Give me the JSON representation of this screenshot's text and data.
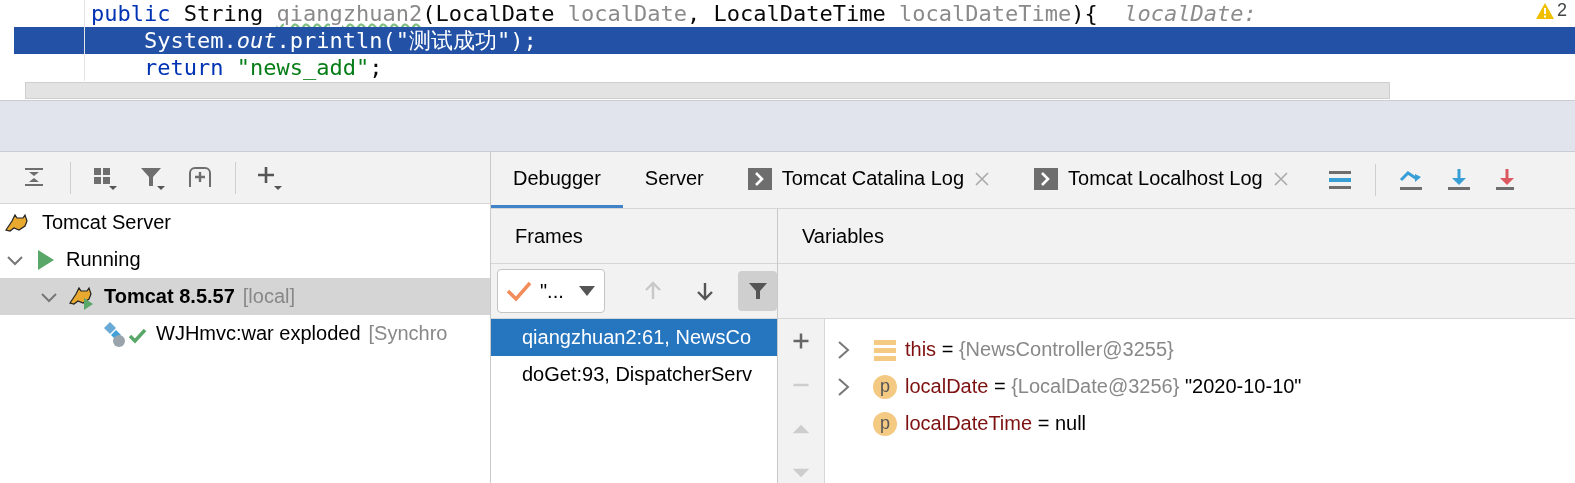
{
  "editor": {
    "lines": [
      {
        "selected": false,
        "tokens": [
          {
            "kind": "keyword",
            "text": "public"
          },
          {
            "kind": "plain",
            "text": " String "
          },
          {
            "kind": "unused",
            "text": "qiangzhuan2"
          },
          {
            "kind": "plain",
            "text": "(LocalDate "
          },
          {
            "kind": "param",
            "text": "localDate"
          },
          {
            "kind": "plain",
            "text": ", LocalDateTime "
          },
          {
            "kind": "param",
            "text": "localDateTime"
          },
          {
            "kind": "plain",
            "text": "){"
          },
          {
            "kind": "hint",
            "text": "  localDate:"
          }
        ]
      },
      {
        "selected": true,
        "tokens": [
          {
            "kind": "plain",
            "text": "    System."
          },
          {
            "kind": "static",
            "text": "out"
          },
          {
            "kind": "plain",
            "text": ".println("
          },
          {
            "kind": "string",
            "text": "\"测试成功\""
          },
          {
            "kind": "plain",
            "text": ");"
          }
        ]
      },
      {
        "selected": false,
        "tokens": [
          {
            "kind": "keyword",
            "text": "    return "
          },
          {
            "kind": "string",
            "text": "\"news_add\""
          },
          {
            "kind": "plain",
            "text": ";"
          }
        ]
      }
    ],
    "warnings": "2"
  },
  "services": {
    "toolbar": [
      {
        "kind": "collapse"
      },
      {
        "kind": "group"
      },
      {
        "kind": "filter"
      },
      {
        "kind": "add-frame"
      },
      {
        "kind": "add"
      }
    ],
    "tree": [
      {
        "label": "Tomcat Server",
        "kind": "server",
        "selected": false,
        "children": [
          {
            "label": "Running",
            "kind": "running",
            "expanded": true,
            "selected": false,
            "children": [
              {
                "label": "Tomcat 8.5.57",
                "detail": "[local]",
                "kind": "instance",
                "expanded": true,
                "selected": true,
                "children": [
                  {
                    "label": "WJHmvc:war exploded",
                    "detail": "[Synchro",
                    "kind": "artifact",
                    "selected": false
                  }
                ]
              }
            ]
          }
        ]
      }
    ]
  },
  "debugger": {
    "tabs": [
      {
        "label": "Debugger",
        "kind": "plain",
        "selected": true,
        "closable": false
      },
      {
        "label": "Server",
        "kind": "plain",
        "selected": false,
        "closable": false
      },
      {
        "label": "Tomcat Catalina Log",
        "kind": "console",
        "selected": false,
        "closable": true
      },
      {
        "label": "Tomcat Localhost Log",
        "kind": "console",
        "selected": false,
        "closable": true
      }
    ],
    "actions": [
      {
        "kind": "layout"
      },
      {
        "kind": "step-over"
      },
      {
        "kind": "step-into"
      },
      {
        "kind": "force-step-into"
      }
    ],
    "frames": {
      "title": "Frames",
      "thread": "\"...",
      "toolbar": [
        {
          "kind": "up",
          "disabled": true,
          "selected": false
        },
        {
          "kind": "down",
          "disabled": false,
          "selected": false
        },
        {
          "kind": "filter",
          "disabled": false,
          "selected": true
        }
      ],
      "items": [
        {
          "label": "qiangzhuan2:61, NewsCo",
          "selected": true
        },
        {
          "label": "doGet:93, DispatcherServ",
          "selected": false
        }
      ]
    },
    "variables": {
      "title": "Variables",
      "toolbar": [
        {
          "kind": "add",
          "disabled": false
        },
        {
          "kind": "remove",
          "disabled": true
        },
        {
          "kind": "move-up",
          "disabled": true
        },
        {
          "kind": "move-down",
          "disabled": true
        }
      ],
      "items": [
        {
          "kind": "field",
          "name": "this",
          "eq": "=",
          "ref": "{NewsController@3255}",
          "expandable": true
        },
        {
          "kind": "param",
          "badge": "p",
          "name": "localDate",
          "eq": "=",
          "ref": "{LocalDate@3256}",
          "text": "\"2020-10-10\"",
          "expandable": true
        },
        {
          "kind": "param",
          "badge": "p",
          "name": "localDateTime",
          "eq": "=",
          "text": "null",
          "expandable": false
        }
      ]
    }
  }
}
